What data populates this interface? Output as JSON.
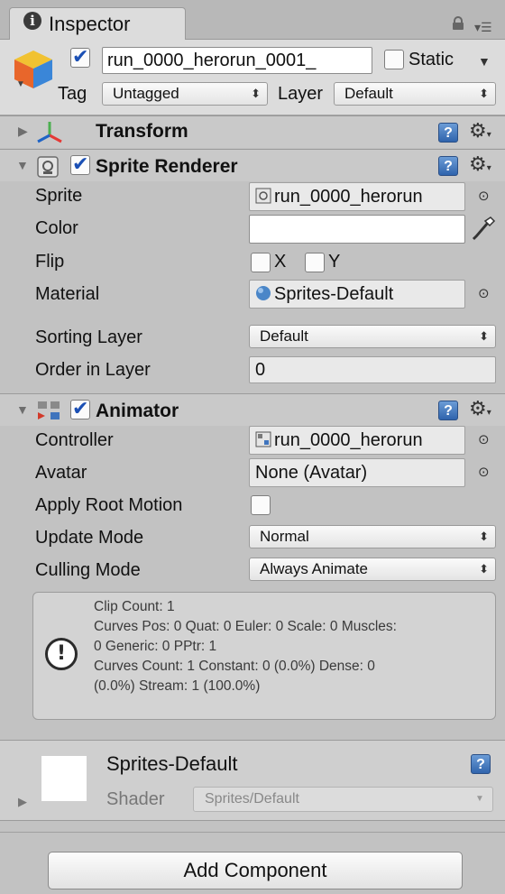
{
  "tab": {
    "title": "Inspector",
    "info_icon": "i"
  },
  "gameobject": {
    "active": true,
    "name": "run_0000_herorun_0001_",
    "static_label": "Static",
    "static_checked": false,
    "tag_label": "Tag",
    "tag_value": "Untagged",
    "layer_label": "Layer",
    "layer_value": "Default"
  },
  "transform": {
    "title": "Transform"
  },
  "sprite_renderer": {
    "title": "Sprite Renderer",
    "enabled": true,
    "sprite_label": "Sprite",
    "sprite_value": "run_0000_herorun",
    "color_label": "Color",
    "color_value": "#ffffff",
    "flip_label": "Flip",
    "flip_x_label": "X",
    "flip_y_label": "Y",
    "flip_x": false,
    "flip_y": false,
    "material_label": "Material",
    "material_value": "Sprites-Default",
    "sorting_layer_label": "Sorting Layer",
    "sorting_layer_value": "Default",
    "order_label": "Order in Layer",
    "order_value": "0"
  },
  "animator": {
    "title": "Animator",
    "enabled": true,
    "controller_label": "Controller",
    "controller_value": "run_0000_herorun",
    "avatar_label": "Avatar",
    "avatar_value": "None (Avatar)",
    "root_motion_label": "Apply Root Motion",
    "root_motion": false,
    "update_mode_label": "Update Mode",
    "update_mode_value": "Normal",
    "culling_mode_label": "Culling Mode",
    "culling_mode_value": "Always Animate",
    "info_lines": [
      "Clip Count: 1",
      "Curves Pos: 0 Quat: 0 Euler: 0 Scale: 0 Muscles:",
      "0 Generic: 0 PPtr: 1",
      "Curves Count: 1 Constant: 0 (0.0%) Dense: 0",
      "(0.0%) Stream: 1 (100.0%)"
    ]
  },
  "material": {
    "name": "Sprites-Default",
    "shader_label": "Shader",
    "shader_value": "Sprites/Default"
  },
  "add_component_label": "Add Component",
  "icons": {
    "help": "?",
    "gear": "⚙",
    "target": "⊙",
    "eyedropper": "eyedropper-icon",
    "popup_arrows": "⬍"
  },
  "colors": {
    "panel_bg": "#c2c2c2",
    "header_bg": "#dcdcdc",
    "component_header_bg": "#c9c9c9",
    "checkbox_check": "#1a4fb4",
    "help_icon": "#3f74bd"
  }
}
